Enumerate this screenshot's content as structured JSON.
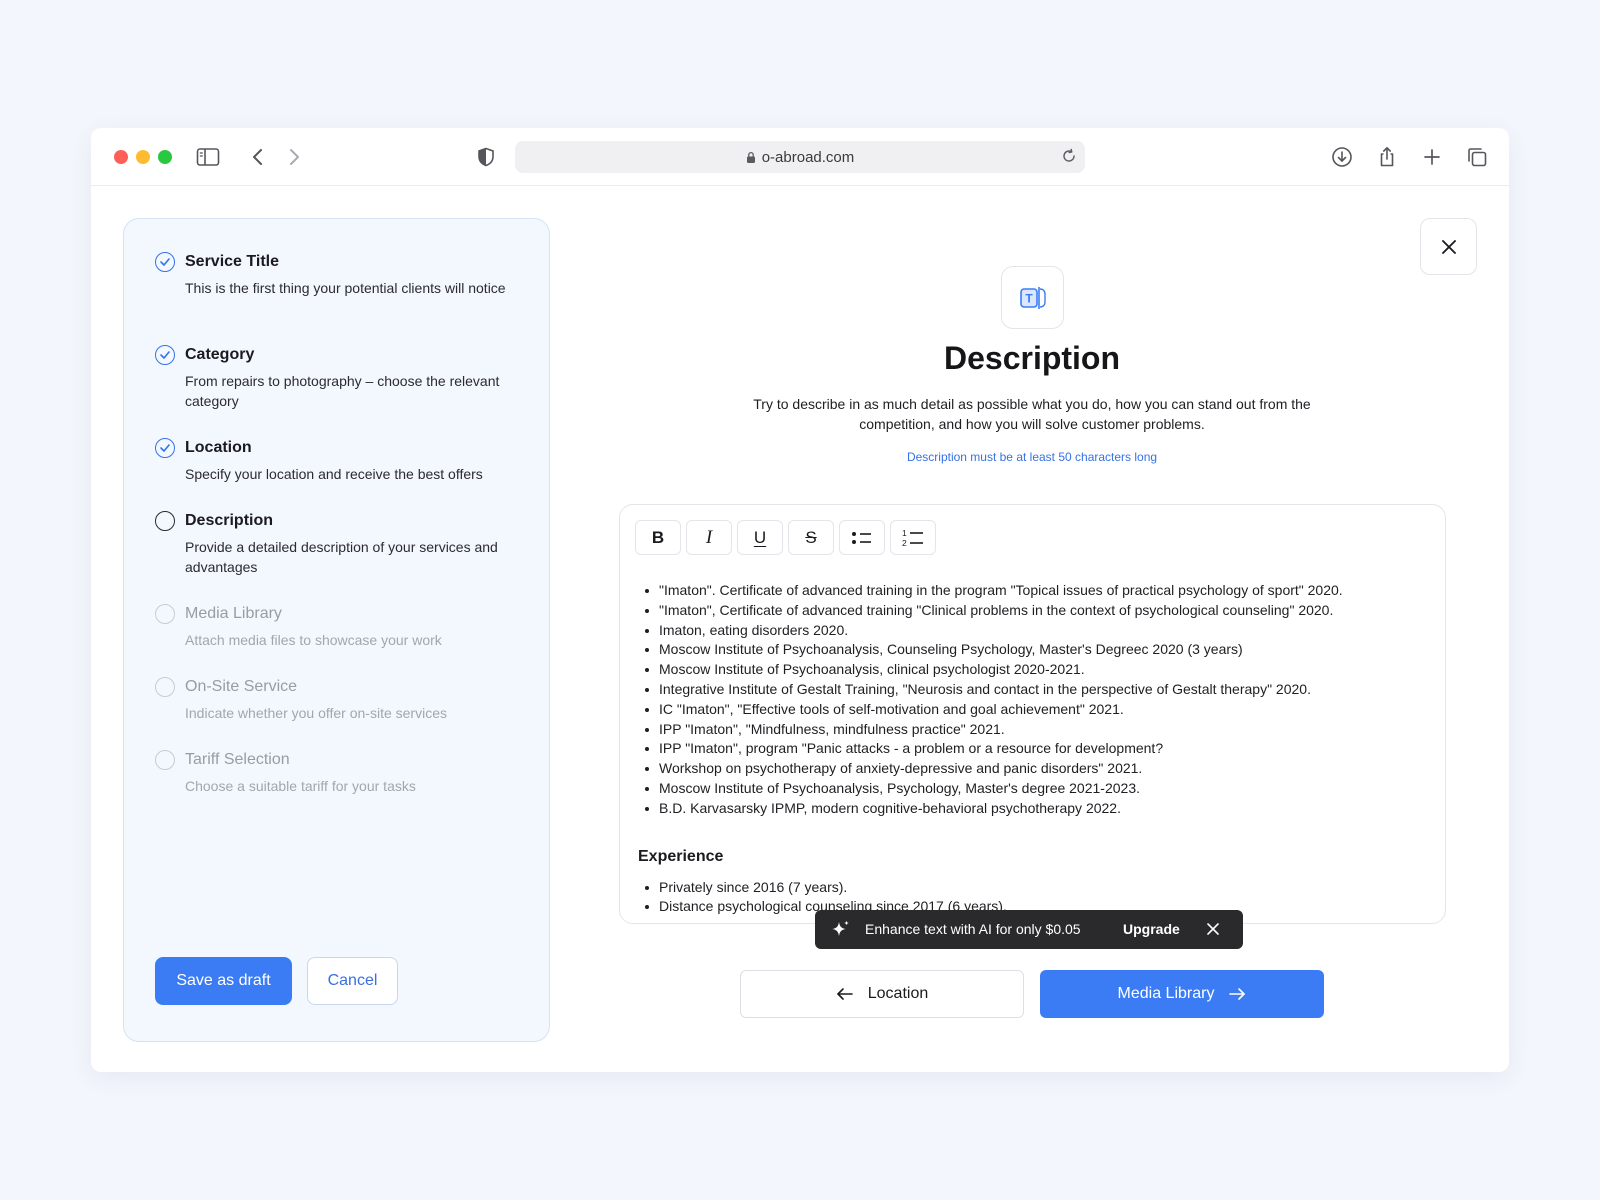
{
  "browser": {
    "url": "o-abroad.com"
  },
  "sidebar": {
    "steps": [
      {
        "title": "Service Title",
        "desc": "This is the first thing your potential clients will notice",
        "state": "done"
      },
      {
        "title": "Category",
        "desc": "From repairs to photography – choose the relevant category",
        "state": "done"
      },
      {
        "title": "Location",
        "desc": "Specify your location and receive the best offers",
        "state": "done"
      },
      {
        "title": "Description",
        "desc": "Provide a detailed description of your services and advantages",
        "state": "current"
      },
      {
        "title": "Media Library",
        "desc": "Attach media files to showcase your work",
        "state": "pending"
      },
      {
        "title": "On-Site Service",
        "desc": "Indicate whether you offer on-site services",
        "state": "pending"
      },
      {
        "title": "Tariff Selection",
        "desc": "Choose a suitable tariff for your tasks",
        "state": "pending"
      }
    ],
    "save_draft_label": "Save as draft",
    "cancel_label": "Cancel"
  },
  "main": {
    "title": "Description",
    "subtitle": "Try to describe in as much detail as possible what you do, how you can stand out from the competition, and how you will solve customer problems.",
    "hint": "Description must be at least 50 characters long",
    "toolbar": {
      "bold": "B",
      "italic": "I",
      "underline": "U",
      "strike": "S"
    },
    "education_items": [
      "\"Imaton\". Certificate of advanced training in the program \"Topical issues of practical psychology of sport\" 2020.",
      "\"Imaton\", Certificate of advanced training \"Clinical problems in the context of psychological counseling\" 2020.",
      "Imaton, eating disorders 2020.",
      "Moscow Institute of Psychoanalysis, Counseling Psychology, Master's Degreec 2020 (3 years)",
      "Moscow Institute of Psychoanalysis, clinical psychologist 2020-2021.",
      "Integrative Institute of Gestalt Training, \"Neurosis and contact in the perspective of Gestalt therapy\" 2020.",
      "IC \"Imaton\", \"Effective tools of self-motivation and goal achievement\" 2021.",
      "IPP \"Imaton\", \"Mindfulness, mindfulness practice\" 2021.",
      "IPP \"Imaton\", program \"Panic attacks - a problem or a resource for development?",
      "Workshop on psychotherapy of anxiety-depressive and panic disorders\" 2021.",
      "Moscow Institute of Psychoanalysis, Psychology, Master's degree 2021-2023.",
      "B.D. Karvasarsky IPMP, modern cognitive-behavioral psychotherapy 2022."
    ],
    "experience_heading": "Experience",
    "experience_items": [
      "Privately since 2016 (7 years).",
      "Distance psychological counseling since 2017 (6 years)."
    ],
    "ai_banner": {
      "text": "Enhance text with AI for only $0.05",
      "upgrade_label": "Upgrade"
    },
    "prev_label": "Location",
    "next_label": "Media Library"
  },
  "colors": {
    "accent": "#3b7cf5",
    "page_bg": "#f3f6fc",
    "sidebar_bg": "#f3f7fe",
    "banner_bg": "#2a2a2c"
  }
}
